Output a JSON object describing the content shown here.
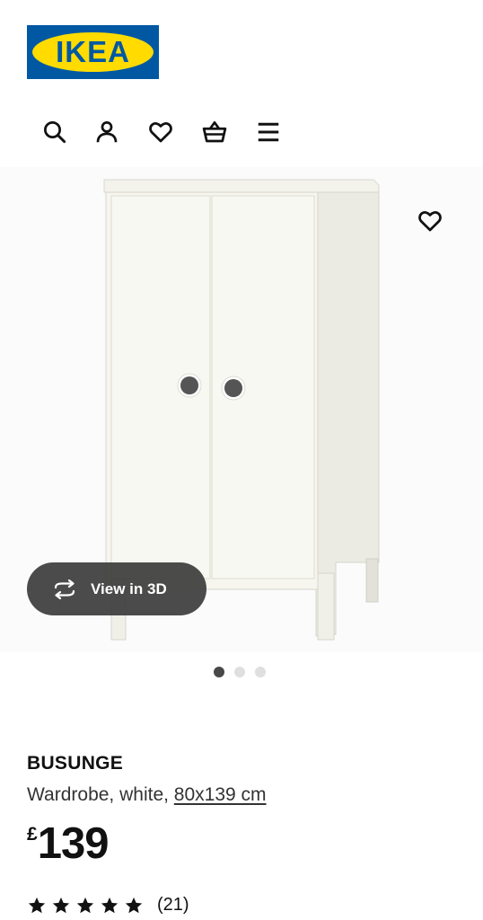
{
  "brand": {
    "logo_text": "IKEA",
    "colors": {
      "blue": "#0058a3",
      "yellow": "#ffdb00"
    }
  },
  "toolbar": {
    "icons": [
      "search-icon",
      "user-icon",
      "heart-icon",
      "basket-icon",
      "menu-icon"
    ]
  },
  "gallery": {
    "view_3d_label": "View in 3D",
    "dots_total": 3,
    "active_dot": 1
  },
  "product": {
    "name": "BUSUNGE",
    "description": "Wardrobe, white, ",
    "size": "80x139 cm",
    "currency": "£",
    "price": "139",
    "rating": {
      "stars": 5,
      "count": "(21)"
    }
  }
}
